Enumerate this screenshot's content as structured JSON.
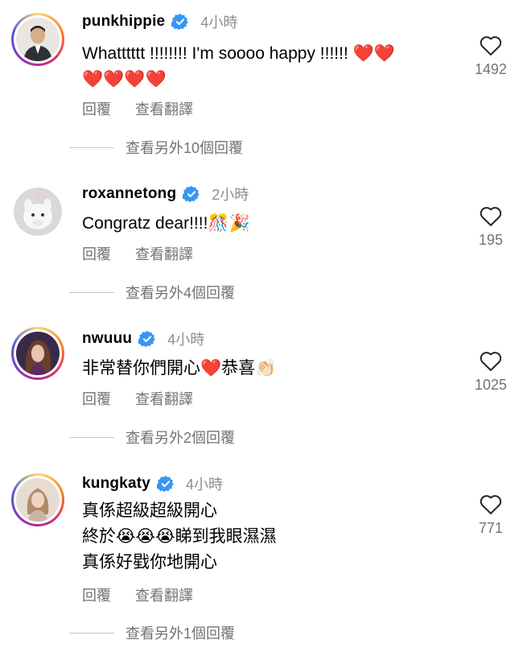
{
  "colors": {
    "verified": "#3897f0",
    "muted": "#737373",
    "heart_emoji": "#e8132b"
  },
  "comments": [
    {
      "username": "punkhippie",
      "time": "4小時",
      "lines": [
        "Whatttttt !!!!!!!! I'm soooo happy !!!!!! ❤️❤️",
        "❤️❤️❤️❤️"
      ],
      "reply_label": "回覆",
      "translate_label": "查看翻譯",
      "likes": "1492",
      "more_replies": "查看另外10個回覆",
      "avatar": "man-in-suit-avatar"
    },
    {
      "username": "roxannetong",
      "time": "2小時",
      "lines": [
        "Congratz dear!!!!🎊🎉"
      ],
      "reply_label": "回覆",
      "translate_label": "查看翻譯",
      "likes": "195",
      "more_replies": "查看另外4個回覆",
      "avatar": "unicorn-avatar"
    },
    {
      "username": "nwuuu",
      "time": "4小時",
      "lines": [
        "非常替你們開心❤️恭喜👏🏻"
      ],
      "reply_label": "回覆",
      "translate_label": "查看翻譯",
      "likes": "1025",
      "more_replies": "查看另外2個回覆",
      "avatar": "woman-avatar"
    },
    {
      "username": "kungkaty",
      "time": "4小時",
      "lines": [
        "真係超級超級開心",
        "終於😭😭😭睇到我眼濕濕",
        "真係好戥你地開心"
      ],
      "reply_label": "回覆",
      "translate_label": "查看翻譯",
      "likes": "771",
      "more_replies": "查看另外1個回覆",
      "avatar": "woman-portrait-avatar"
    }
  ]
}
